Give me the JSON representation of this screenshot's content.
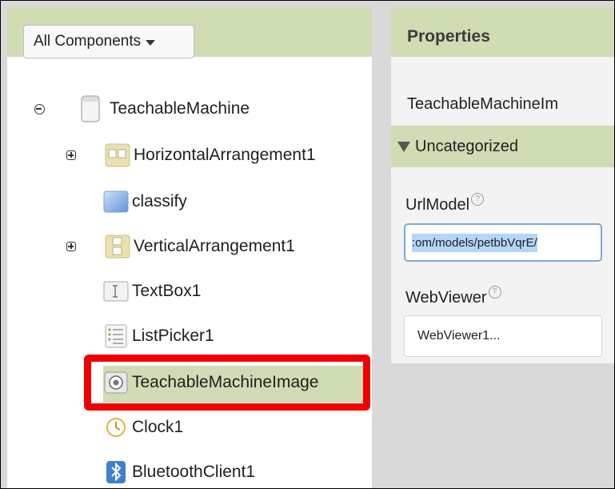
{
  "components": {
    "dropdown_label": "All Components",
    "tree": [
      {
        "label": "TeachableMachine",
        "toggle": "collapse",
        "icon": "screen-icon"
      },
      {
        "label": "HorizontalArrangement1",
        "toggle": "expand",
        "icon": "horizontal-arrangement-icon"
      },
      {
        "label": "classify",
        "icon": "button-icon"
      },
      {
        "label": "VerticalArrangement1",
        "toggle": "expand",
        "icon": "vertical-arrangement-icon"
      },
      {
        "label": "TextBox1",
        "icon": "textbox-icon"
      },
      {
        "label": "ListPicker1",
        "icon": "listpicker-icon"
      },
      {
        "label": "TeachableMachineImage",
        "icon": "teachable-machine-image-icon",
        "selected": true
      },
      {
        "label": "Clock1",
        "icon": "clock-icon"
      },
      {
        "label": "BluetoothClient1",
        "icon": "bluetooth-icon"
      }
    ]
  },
  "properties": {
    "title": "Properties",
    "component_name": "TeachableMachineIm",
    "category": "Uncategorized",
    "url_model_label": "UrlModel",
    "url_model_value": ":om/models/petbbVqrE/",
    "webviewer_label": "WebViewer",
    "webviewer_value": "WebViewer1...",
    "help_glyph": "?"
  },
  "colors": {
    "header_green": "#cfdcb4",
    "highlight_red": "#f20000",
    "selection_blue": "#b5d5f8"
  }
}
